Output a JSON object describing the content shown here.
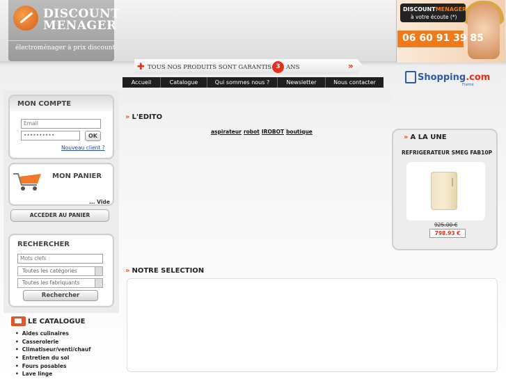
{
  "header": {
    "logo_line1": "DISCOUNT",
    "logo_line2": "MENAGER",
    "tagline": "électroménager à prix discount",
    "phone_brand_a": "DISCOUNT",
    "phone_brand_b": "MENAGER",
    "phone_sub": "à votre écoute (*)",
    "phone_number": "06 60 91 39 85"
  },
  "banner": {
    "text_before": "TOUS NOS PRODUITS SONT GARANTIS",
    "years": "3",
    "text_after": "ANS",
    "arrow": "»"
  },
  "nav": {
    "items": [
      "Accueil",
      "Catalogue",
      "Qui sommes nous ?",
      "Newsletter",
      "Nous contacter"
    ]
  },
  "partner": {
    "name_a": "Shopping",
    "name_b": ".com",
    "country": "France"
  },
  "account": {
    "title": "MON COMPTE",
    "email_placeholder": "Email",
    "password_value": "••••••••••",
    "ok_label": "OK",
    "new_client": "Nouveau client ?"
  },
  "cart": {
    "title": "MON PANIER",
    "status": "... Vide",
    "button": "ACCEDER AU PANIER"
  },
  "search": {
    "title": "RECHERCHER",
    "keyword_placeholder": "Mots clefs",
    "category_select": "Toutes les catégories",
    "manufacturer_select": "Toutes les fabriquants",
    "button": "Rechercher"
  },
  "catalogue": {
    "title": "LE CATALOGUE",
    "items": [
      "Aides culinaires",
      "Casserolerie",
      "Climatiseur/venti/chauf",
      "Entretien du sol",
      "Fours posables",
      "Lave linge"
    ]
  },
  "edito": {
    "title": "L'EDITO",
    "tags": [
      "aspirateur",
      "robot",
      "IROBOT",
      "boutique"
    ]
  },
  "featured": {
    "title": "A LA UNE",
    "product": "REFRIGERATEUR SMEG FAB10P",
    "old_price": "925.00 €",
    "new_price": "798.93 €"
  },
  "selection": {
    "title": "NOTRE SELECTION"
  },
  "colors": {
    "accent_orange": "#e2572a",
    "accent_red": "#e2301b",
    "nav_bg": "#1f1f1f",
    "link_blue": "#2a4b9a"
  }
}
